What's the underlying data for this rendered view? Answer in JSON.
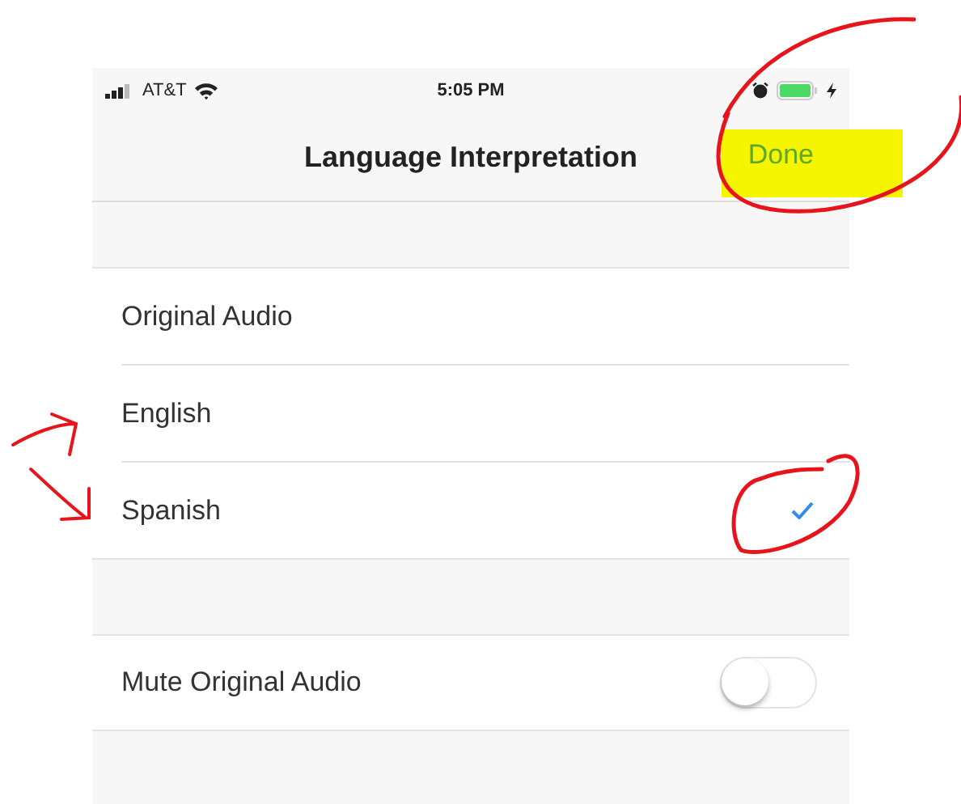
{
  "status_bar": {
    "carrier": "AT&T",
    "time": "5:05 PM",
    "charging": true
  },
  "nav": {
    "title": "Language Interpretation",
    "done": "Done"
  },
  "languages": [
    {
      "label": "Original Audio",
      "selected": false
    },
    {
      "label": "English",
      "selected": false
    },
    {
      "label": "Spanish",
      "selected": true
    }
  ],
  "mute_row": {
    "label": "Mute Original Audio",
    "on": false
  },
  "annotations": [
    {
      "kind": "circle"
    },
    {
      "kind": "highlight"
    },
    {
      "kind": "arrow"
    },
    {
      "kind": "arrow"
    },
    {
      "kind": "circle"
    }
  ]
}
